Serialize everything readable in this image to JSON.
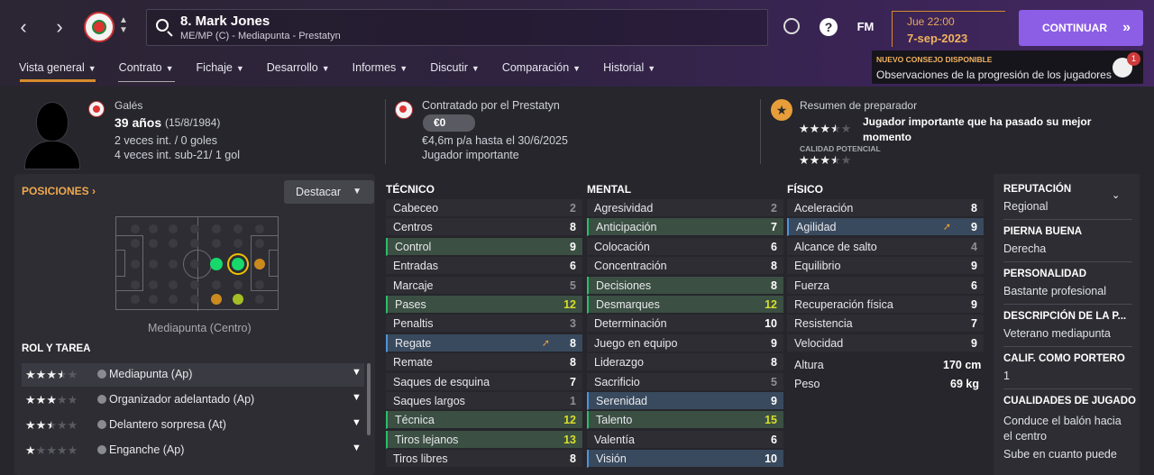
{
  "nav": {
    "back": "‹",
    "forward": "›"
  },
  "player": {
    "title": "8. Mark Jones",
    "subtitle": "ME/MP (C) - Mediapunta - Prestatyn",
    "nationality": "Galés",
    "age": "39 años",
    "dob": "(15/8/1984)",
    "caps": "2 veces int. / 0 goles",
    "u21": "4 veces int. sub-21/ 1 gol"
  },
  "date": {
    "time": "Jue 22:00",
    "day": "7-sep-2023"
  },
  "topicons": {
    "help": "?",
    "fm": "FM"
  },
  "continue_label": "CONTINUAR",
  "advice": {
    "title": "NUEVO CONSEJO DISPONIBLE",
    "text": "Observaciones de la progresión de los jugadores",
    "count": "1"
  },
  "tabs": [
    {
      "label": "Vista general"
    },
    {
      "label": "Contrato"
    },
    {
      "label": "Fichaje"
    },
    {
      "label": "Desarrollo"
    },
    {
      "label": "Informes"
    },
    {
      "label": "Discutir"
    },
    {
      "label": "Comparación"
    },
    {
      "label": "Historial"
    }
  ],
  "contract": {
    "club_line": "Contratado por el Prestatyn",
    "value": "€0",
    "wage": "€4,6m p/a hasta el 30/6/2025",
    "status": "Jugador importante"
  },
  "coach": {
    "title": "Resumen de preparador",
    "current_stars": 3.5,
    "summary": "Jugador importante que ha pasado su mejor momento",
    "potential_label": "CALIDAD POTENCIAL",
    "potential_stars": 3.5
  },
  "positions": {
    "title": "POSICIONES ›",
    "destacar": "Destacar",
    "label": "Mediapunta (Centro)"
  },
  "roles": {
    "title": "ROL Y TAREA",
    "items": [
      {
        "stars": 3.5,
        "label": "Mediapunta (Ap)"
      },
      {
        "stars": 3,
        "label": "Organizador adelantado (Ap)"
      },
      {
        "stars": 2.5,
        "label": "Delantero sorpresa (At)"
      },
      {
        "stars": 1,
        "label": "Enganche (Ap)"
      }
    ]
  },
  "attributes": {
    "tecnico": {
      "title": "TÉCNICO",
      "items": [
        {
          "name": "Cabeceo",
          "value": "2"
        },
        {
          "name": "Centros",
          "value": "8"
        },
        {
          "name": "Control",
          "value": "9"
        },
        {
          "name": "Entradas",
          "value": "6"
        },
        {
          "name": "Marcaje",
          "value": "5"
        },
        {
          "name": "Pases",
          "value": "12"
        },
        {
          "name": "Penaltis",
          "value": "3"
        },
        {
          "name": "Regate",
          "value": "8"
        },
        {
          "name": "Remate",
          "value": "8"
        },
        {
          "name": "Saques de esquina",
          "value": "7"
        },
        {
          "name": "Saques largos",
          "value": "1"
        },
        {
          "name": "Técnica",
          "value": "12"
        },
        {
          "name": "Tiros lejanos",
          "value": "13"
        },
        {
          "name": "Tiros libres",
          "value": "8"
        }
      ]
    },
    "mental": {
      "title": "MENTAL",
      "items": [
        {
          "name": "Agresividad",
          "value": "2"
        },
        {
          "name": "Anticipación",
          "value": "7"
        },
        {
          "name": "Colocación",
          "value": "6"
        },
        {
          "name": "Concentración",
          "value": "8"
        },
        {
          "name": "Decisiones",
          "value": "8"
        },
        {
          "name": "Desmarques",
          "value": "12"
        },
        {
          "name": "Determinación",
          "value": "10"
        },
        {
          "name": "Juego en equipo",
          "value": "9"
        },
        {
          "name": "Liderazgo",
          "value": "8"
        },
        {
          "name": "Sacrificio",
          "value": "5"
        },
        {
          "name": "Serenidad",
          "value": "9"
        },
        {
          "name": "Talento",
          "value": "15"
        },
        {
          "name": "Valentía",
          "value": "6"
        },
        {
          "name": "Visión",
          "value": "10"
        }
      ]
    },
    "fisico": {
      "title": "FÍSICO",
      "items": [
        {
          "name": "Aceleración",
          "value": "8"
        },
        {
          "name": "Agilidad",
          "value": "9"
        },
        {
          "name": "Alcance de salto",
          "value": "4"
        },
        {
          "name": "Equilibrio",
          "value": "9"
        },
        {
          "name": "Fuerza",
          "value": "6"
        },
        {
          "name": "Recuperación física",
          "value": "9"
        },
        {
          "name": "Resistencia",
          "value": "7"
        },
        {
          "name": "Velocidad",
          "value": "9"
        }
      ],
      "height_label": "Altura",
      "height": "170 cm",
      "weight_label": "Peso",
      "weight": "69 kg"
    }
  },
  "side": {
    "reputation_h": "REPUTACIÓN",
    "reputation": "Regional",
    "foot_h": "PIERNA BUENA",
    "foot": "Derecha",
    "personality_h": "PERSONALIDAD",
    "personality": "Bastante profesional",
    "description_h": "DESCRIPCIÓN DE LA P...",
    "description": "Veterano mediapunta",
    "gk_h": "CALIF. COMO PORTERO",
    "gk": "1",
    "qualities_h": "CUALIDADES DE JUGADO",
    "quality1a": "Conduce el balón hacia",
    "quality1b": "el centro",
    "quality2": "Sube en cuanto puede"
  },
  "colors": {
    "accent": "#d58b2a",
    "continue": "#8c5ee6",
    "green": "#2bbd6a",
    "blue": "#4f94d9",
    "highlight": "#d9de2a"
  }
}
